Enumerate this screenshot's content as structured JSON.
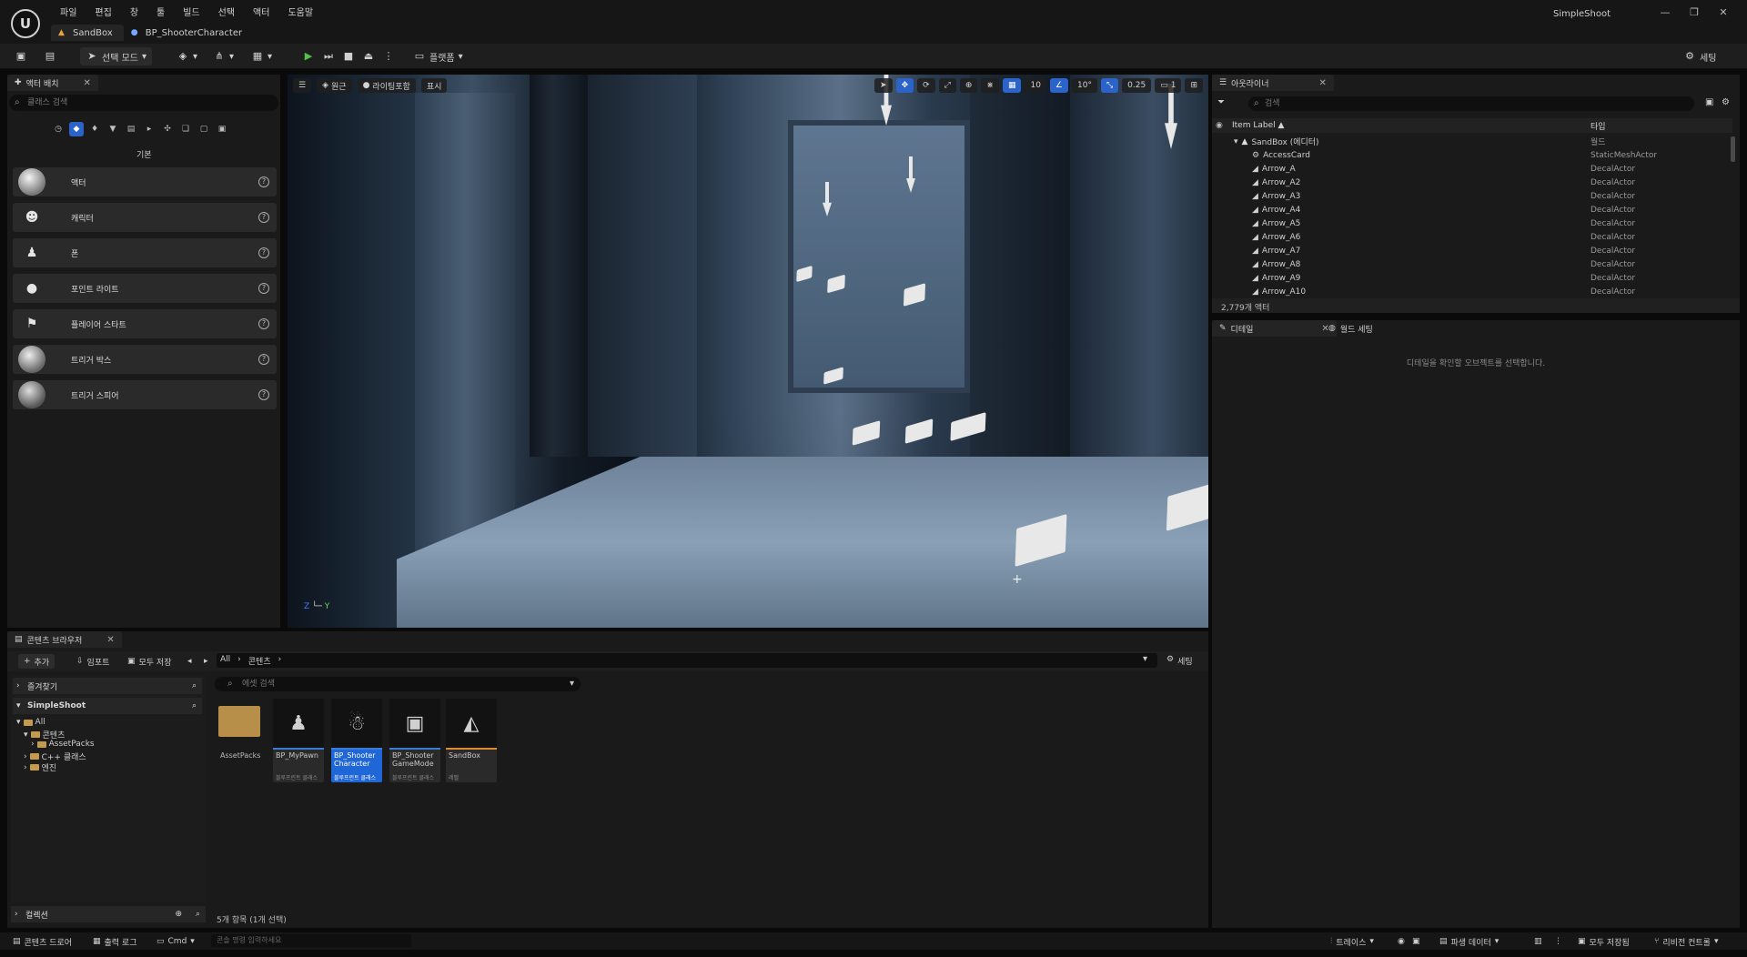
{
  "app": {
    "logo": "U",
    "project_name": "SimpleShoot",
    "menu": [
      "파일",
      "편집",
      "창",
      "툴",
      "빌드",
      "선택",
      "액터",
      "도움말"
    ],
    "tabs": [
      {
        "label": "SandBox",
        "icon": "level-icon",
        "active": true
      },
      {
        "label": "BP_ShooterCharacter",
        "icon": "blueprint-icon",
        "active": false
      }
    ],
    "window_controls": [
      "—",
      "❐",
      "✕"
    ]
  },
  "toolbar": {
    "select_mode": "선택 모드",
    "platforms": "플랫폼",
    "settings": "세팅"
  },
  "place_actors": {
    "tab_label": "액터 배치",
    "search_placeholder": "클래스 검색",
    "section": "기본",
    "items": [
      {
        "label": "액터",
        "icon": "actor-icon"
      },
      {
        "label": "캐릭터",
        "icon": "character-icon"
      },
      {
        "label": "폰",
        "icon": "pawn-icon"
      },
      {
        "label": "포인트 라이트",
        "icon": "point-light-icon"
      },
      {
        "label": "플레이어 스타트",
        "icon": "player-start-icon"
      },
      {
        "label": "트리거 박스",
        "icon": "trigger-box-icon"
      },
      {
        "label": "트리거 스피어",
        "icon": "trigger-sphere-icon"
      }
    ]
  },
  "viewport": {
    "perspective": "원근",
    "lit": "라이팅포함",
    "show": "표시",
    "grid_snap": "10",
    "rotation_snap": "10°",
    "scale_snap": "0.25",
    "camera_speed": "1",
    "axis_z": "Z",
    "axis_y": "Y"
  },
  "outliner": {
    "tab_label": "아웃라이너",
    "search_placeholder": "검색",
    "col_label": "Item Label ▲",
    "col_type": "타입",
    "root": {
      "name": "SandBox (에디터)",
      "type": "월드"
    },
    "rows": [
      {
        "name": "AccessCard",
        "type": "StaticMeshActor"
      },
      {
        "name": "Arrow_A",
        "type": "DecalActor"
      },
      {
        "name": "Arrow_A2",
        "type": "DecalActor"
      },
      {
        "name": "Arrow_A3",
        "type": "DecalActor"
      },
      {
        "name": "Arrow_A4",
        "type": "DecalActor"
      },
      {
        "name": "Arrow_A5",
        "type": "DecalActor"
      },
      {
        "name": "Arrow_A6",
        "type": "DecalActor"
      },
      {
        "name": "Arrow_A7",
        "type": "DecalActor"
      },
      {
        "name": "Arrow_A8",
        "type": "DecalActor"
      },
      {
        "name": "Arrow_A9",
        "type": "DecalActor"
      },
      {
        "name": "Arrow_A10",
        "type": "DecalActor"
      }
    ],
    "count": "2,779개 액터"
  },
  "details": {
    "tab_details": "디테일",
    "tab_world": "월드 세팅",
    "empty_text": "디테일을 확인할 오브젝트를 선택합니다."
  },
  "content_browser": {
    "tab_label": "콘텐츠 브라우저",
    "add": "추가",
    "import": "임포트",
    "save_all": "모두 저장",
    "path": [
      "All",
      "콘텐츠"
    ],
    "settings": "세팅",
    "favorites": "즐겨찾기",
    "project": "SimpleShoot",
    "tree": [
      "All",
      "콘텐츠",
      "AssetPacks",
      "C++ 클래스",
      "엔진"
    ],
    "search_placeholder": "에셋 검색",
    "folder_label": "AssetPacks",
    "assets": [
      {
        "name": "BP_MyPawn",
        "kind": "블루프린트 클래스",
        "selected": false,
        "bar": "#3a7bd5",
        "icon": "pawn-icon"
      },
      {
        "name": "BP_Shooter Character",
        "kind": "블루프린트 클래스",
        "selected": true,
        "bar": "#3a7bd5",
        "icon": "character-icon"
      },
      {
        "name": "BP_Shooter GameMode",
        "kind": "블루프린트 클래스",
        "selected": false,
        "bar": "#3a7bd5",
        "icon": "gamemode-icon"
      },
      {
        "name": "SandBox",
        "kind": "레벨",
        "selected": false,
        "bar": "#e08a2c",
        "icon": "level-icon"
      }
    ],
    "collections": "컬렉션",
    "count": "5개 항목 (1개 선택)"
  },
  "statusbar": {
    "content_drawer": "콘텐츠 드로어",
    "output_log": "출력 로그",
    "cmd": "Cmd",
    "console_placeholder": "콘솔 명령 입력하세요",
    "trace": "트레이스",
    "derived_data": "파생 데이터",
    "save_all": "모두 저장됨",
    "revision": "리비전 컨트롤"
  }
}
